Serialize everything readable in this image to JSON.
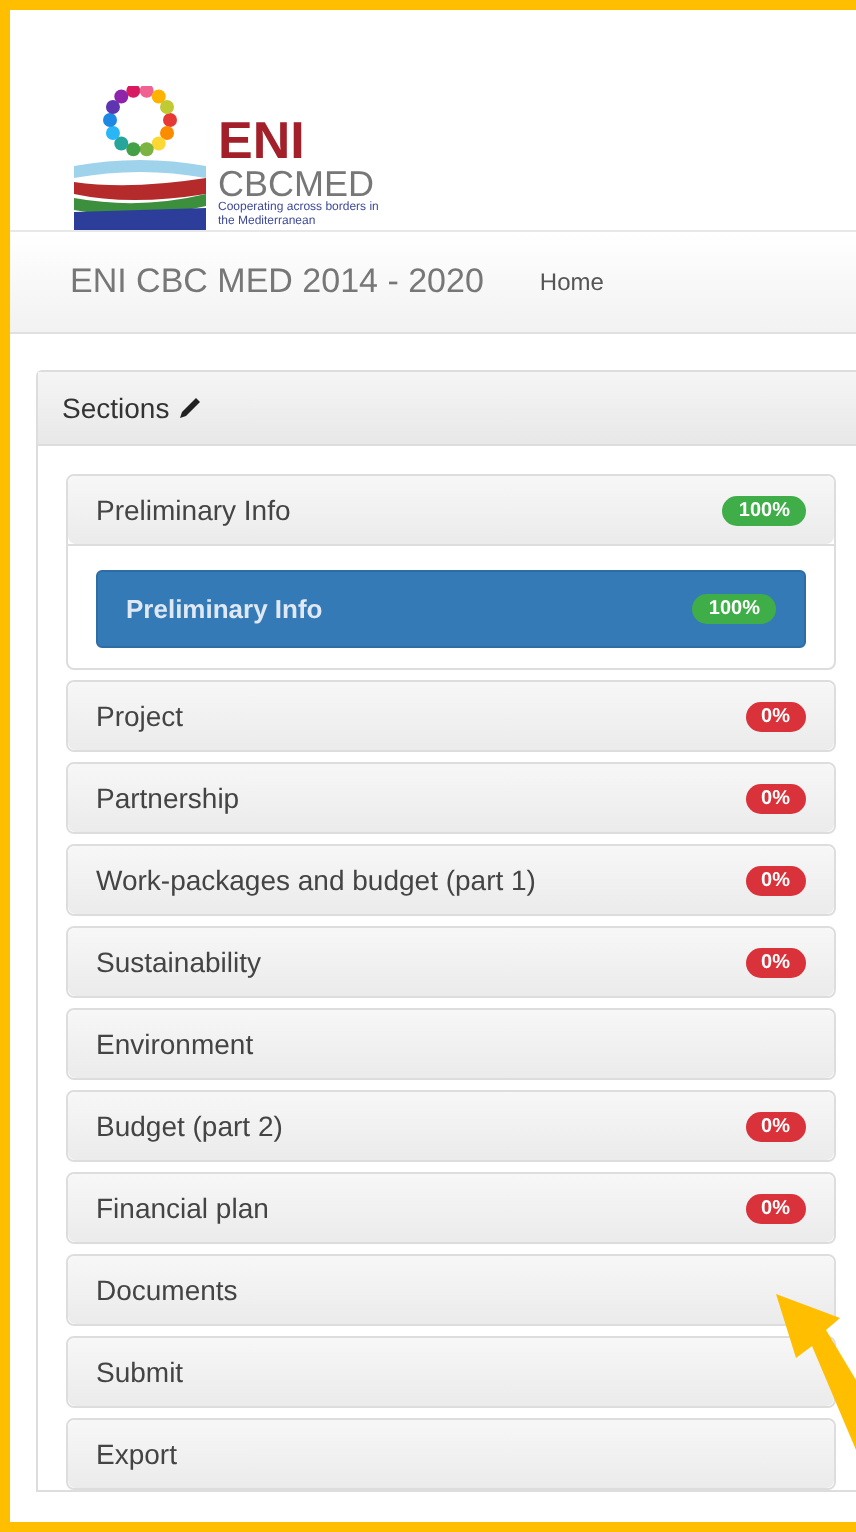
{
  "logo": {
    "title": "ENI",
    "subtitle": "CBCMED",
    "tagline": "Cooperating across borders in the Mediterranean"
  },
  "navbar": {
    "brand": "ENI CBC MED 2014 - 2020",
    "links": [
      "Home"
    ]
  },
  "sections": {
    "title": "Sections",
    "items": [
      {
        "label": "Preliminary Info",
        "badge": {
          "text": "100%",
          "color": "#3fae49"
        },
        "children": [
          {
            "label": "Preliminary Info",
            "selected": true,
            "badge": {
              "text": "100%",
              "color": "#3fae49"
            }
          }
        ]
      },
      {
        "label": "Project",
        "badge": {
          "text": "0%",
          "color": "#d9323a"
        }
      },
      {
        "label": "Partnership",
        "badge": {
          "text": "0%",
          "color": "#d9323a"
        }
      },
      {
        "label": "Work-packages and budget (part 1)",
        "badge": {
          "text": "0%",
          "color": "#d9323a"
        }
      },
      {
        "label": "Sustainability",
        "badge": {
          "text": "0%",
          "color": "#d9323a"
        }
      },
      {
        "label": "Environment"
      },
      {
        "label": "Budget (part 2)",
        "badge": {
          "text": "0%",
          "color": "#d9323a"
        }
      },
      {
        "label": "Financial plan",
        "badge": {
          "text": "0%",
          "color": "#d9323a"
        }
      },
      {
        "label": "Documents"
      },
      {
        "label": "Submit"
      },
      {
        "label": "Export"
      }
    ]
  }
}
